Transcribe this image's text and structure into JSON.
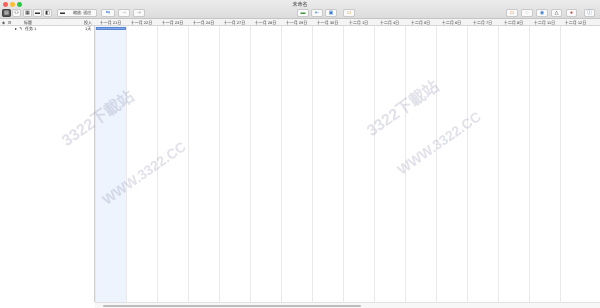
{
  "window": {
    "title": "未命名"
  },
  "toolbar": {
    "zoom_label": "缩放: 适应",
    "items": [
      {
        "name": "view-outline-icon"
      },
      {
        "name": "people-icon"
      },
      {
        "name": "table-icon"
      },
      {
        "name": "sheet-icon"
      },
      {
        "name": "grid-icon"
      },
      {
        "name": "link-icon"
      },
      {
        "name": "unlink-icon"
      },
      {
        "name": "indent-icon"
      },
      {
        "name": "milestone-icon"
      },
      {
        "name": "outdent-icon"
      },
      {
        "name": "resource-icon"
      },
      {
        "name": "calendar-icon"
      },
      {
        "name": "network-icon"
      },
      {
        "name": "eye-icon"
      },
      {
        "name": "warning-icon"
      },
      {
        "name": "stop-icon"
      },
      {
        "name": "info-icon"
      }
    ]
  },
  "table": {
    "header_col1": "标题",
    "header_col2": "投入",
    "tasks": [
      {
        "title": "任务 1",
        "effort": "1天"
      }
    ]
  },
  "dates": [
    "十一月 21日",
    "十一月 22日",
    "十一月 23日",
    "十一月 24日",
    "十一月 27日",
    "十一月 28日",
    "十一月 29日",
    "十一月 30日",
    "十二月 1日",
    "十二月 4日",
    "十二月 5日",
    "十二月 6日",
    "十二月 7日",
    "十二月 8日",
    "十二月 11日",
    "十二月 12日"
  ],
  "watermarks": [
    "3322下載站",
    "WWW.3322.CC",
    "3322下載站",
    "WWW.3322.CC"
  ],
  "colors": {
    "accent": "#7ea6e6",
    "today": "#eef4fd",
    "close": "#ff5f57",
    "minimize": "#febc2e",
    "maximize": "#28c840"
  }
}
